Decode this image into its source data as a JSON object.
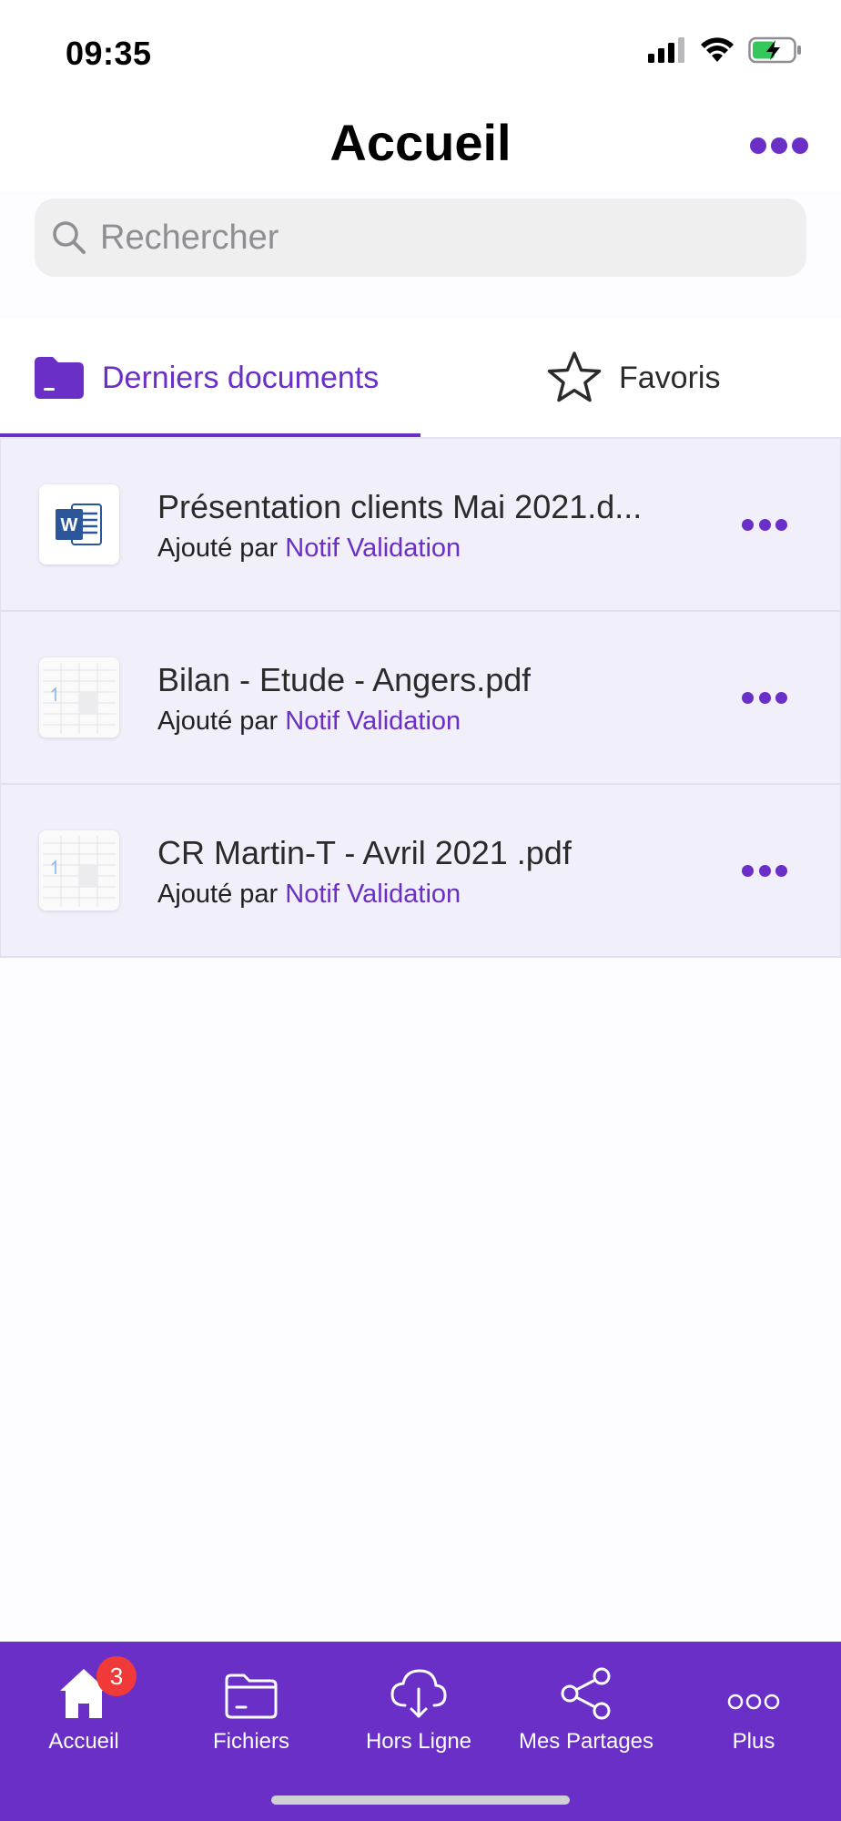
{
  "status_bar": {
    "time": "09:35",
    "battery_color": "#34c759"
  },
  "header": {
    "title": "Accueil",
    "more_icon": "ellipsis-icon"
  },
  "search": {
    "placeholder": "Rechercher",
    "value": ""
  },
  "tabs": [
    {
      "label": "Derniers documents",
      "icon": "folder-icon",
      "active": true
    },
    {
      "label": "Favoris",
      "icon": "star-icon",
      "active": false
    }
  ],
  "documents": [
    {
      "title": "Présentation clients Mai 2021.d...",
      "added_by_prefix": "Ajouté par",
      "author": "Notif Validation",
      "thumb": "word-icon"
    },
    {
      "title": "Bilan - Etude - Angers.pdf",
      "added_by_prefix": "Ajouté par",
      "author": "Notif Validation",
      "thumb": "pdf-thumbnail"
    },
    {
      "title": "CR Martin-T - Avril 2021 .pdf",
      "added_by_prefix": "Ajouté par",
      "author": "Notif Validation",
      "thumb": "pdf-thumbnail"
    }
  ],
  "bottom_nav": [
    {
      "label": "Accueil",
      "icon": "home-icon",
      "badge": "3"
    },
    {
      "label": "Fichiers",
      "icon": "folder-outline-icon"
    },
    {
      "label": "Hors Ligne",
      "icon": "cloud-download-icon"
    },
    {
      "label": "Mes Partages",
      "icon": "share-icon"
    },
    {
      "label": "Plus",
      "icon": "more-circles-icon"
    }
  ],
  "colors": {
    "accent": "#6a2fc6",
    "list_bg": "#f1eff9",
    "badge": "#f03a3a"
  }
}
